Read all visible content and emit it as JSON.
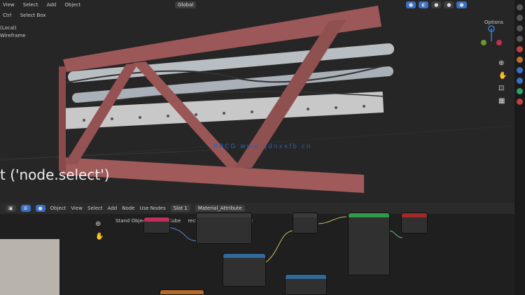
{
  "viewport": {
    "menu": [
      "View",
      "Select",
      "Add",
      "Object"
    ],
    "submenu": [
      "Ctrl",
      "Select Box"
    ],
    "mode_label": "Global",
    "options_label": "Options",
    "info_lines": [
      "(Local)",
      "Wireframe"
    ],
    "watermark": "RRCG www.qdnxxfb.cn",
    "overlay_text": "t ('node.select')"
  },
  "node_editor": {
    "header": [
      "Object",
      "View",
      "Select",
      "Add",
      "Node",
      "Use Nodes"
    ],
    "slot": "Slot 1",
    "material": "Material_Attribute",
    "breadcrumb": [
      "Stand Object",
      "Edge Cube",
      "rectangle_profile_attribute"
    ]
  },
  "colors": {
    "accent": "#3a6fc4",
    "truss": "#9a5656",
    "frame": "#b06060"
  }
}
